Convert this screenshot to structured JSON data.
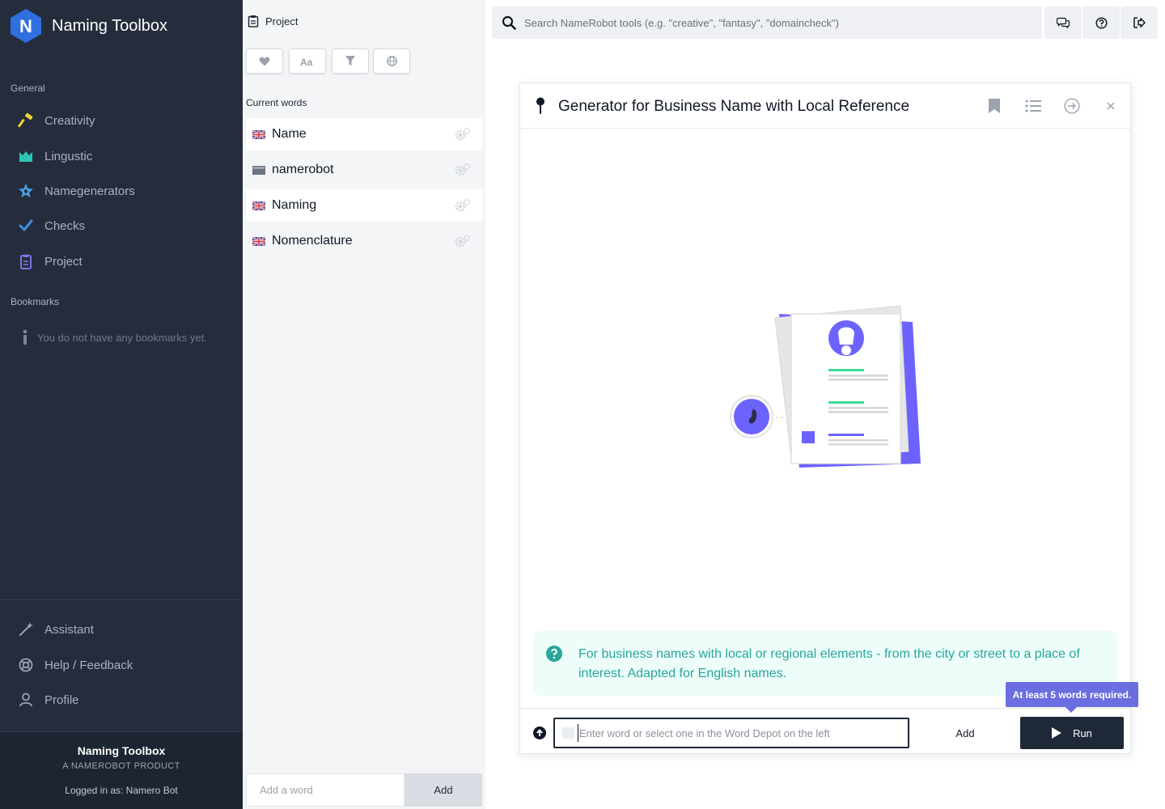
{
  "sidebar": {
    "brand": {
      "logo_letter": "N",
      "title": "Naming Toolbox"
    },
    "sections": {
      "general": "General",
      "bookmarks": "Bookmarks"
    },
    "nav": [
      {
        "label": "Creativity",
        "icon": "hammer-icon",
        "color": "#f2d233"
      },
      {
        "label": "Lingustic",
        "icon": "chart-icon",
        "color": "#2cc6b4"
      },
      {
        "label": "Namegenerators",
        "icon": "star-icon",
        "color": "#4a9de0"
      },
      {
        "label": "Checks",
        "icon": "check-icon",
        "color": "#3f8fe0"
      },
      {
        "label": "Project",
        "icon": "clipboard-icon",
        "color": "#7b74e0"
      }
    ],
    "bookmarks_empty": "You do not have any bookmarks yet.",
    "bottom_nav": [
      {
        "label": "Assistant",
        "icon": "magic-wand-icon"
      },
      {
        "label": "Help / Feedback",
        "icon": "lifebuoy-icon"
      },
      {
        "label": "Profile",
        "icon": "user-icon"
      }
    ],
    "footer": {
      "title": "Naming Toolbox",
      "subtitle": "A NAMEROBOT PRODUCT",
      "logged_in": "Logged in as: Namero Bot"
    }
  },
  "depot": {
    "header": "Project",
    "filters": [
      "heart-icon",
      "font-case-icon",
      "filter-icon",
      "globe-icon"
    ],
    "current_words_label": "Current words",
    "words": [
      {
        "text": "Name",
        "flag": "uk-flag-icon"
      },
      {
        "text": "namerobot",
        "flag": "neutral-flag-icon"
      },
      {
        "text": "Naming",
        "flag": "uk-flag-icon"
      },
      {
        "text": "Nomenclature",
        "flag": "uk-flag-icon"
      }
    ],
    "add_placeholder": "Add a word",
    "add_label": "Add"
  },
  "topbar": {
    "search_placeholder": "Search NameRobot tools (e.g. \"creative\", \"fantasy\", \"domaincheck\")",
    "buttons": [
      "chat-icon",
      "help-circle-icon",
      "logout-icon"
    ]
  },
  "tool": {
    "title": "Generator for Business Name with Local Reference",
    "hint": "For business names with local or regional elements - from the city or street to a place of interest. Adapted for English names.",
    "word_input_placeholder": "Enter word or select one in the Word Depot on the left",
    "add_label": "Add",
    "run_label": "Run",
    "tooltip": "At least 5 words required."
  },
  "colors": {
    "sidebar_bg": "#252d3c",
    "accent_purple": "#6b6ee0",
    "hint_bg": "#ecfdfa",
    "hint_text": "#2aa69a",
    "run_bg": "#1f2937"
  }
}
